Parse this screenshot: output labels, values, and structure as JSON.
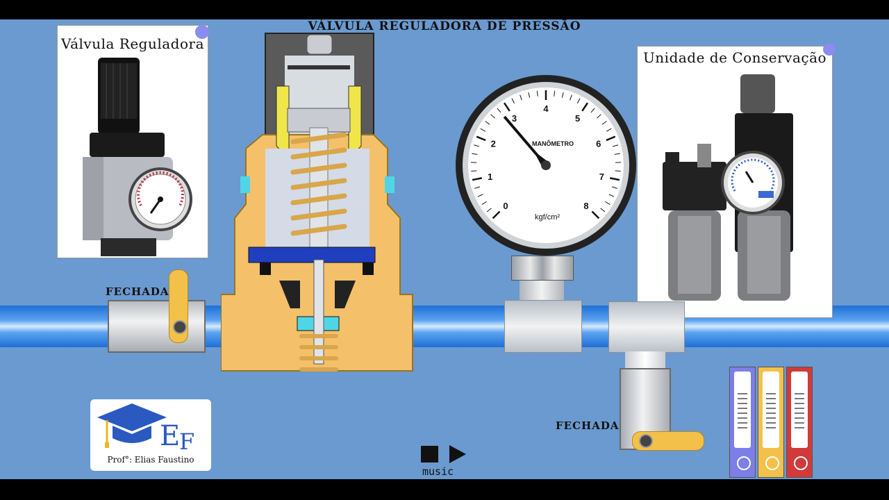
{
  "header": {
    "title": "VÁLVULA REGULADORA DE PRESSÃO"
  },
  "left_card": {
    "title": "Válvula Reguladora"
  },
  "right_card": {
    "title": "Unidade de Conservação"
  },
  "valve_left": {
    "state": "FECHADA"
  },
  "valve_bottom": {
    "state": "FECHADA"
  },
  "gauge": {
    "label": "MANÔMETRO",
    "unit": "kgf/cm²",
    "ticks": [
      "0",
      "1",
      "2",
      "3",
      "4",
      "5",
      "6",
      "7",
      "8"
    ],
    "reading": 2.8
  },
  "logo": {
    "initials_e": "E",
    "initials_f": "F",
    "caption": "Prof°: Elias Faustino"
  },
  "player": {
    "label": "music"
  },
  "binders": {
    "colors": [
      "#7e7ee8",
      "#f3c14a",
      "#d23a3a"
    ]
  }
}
